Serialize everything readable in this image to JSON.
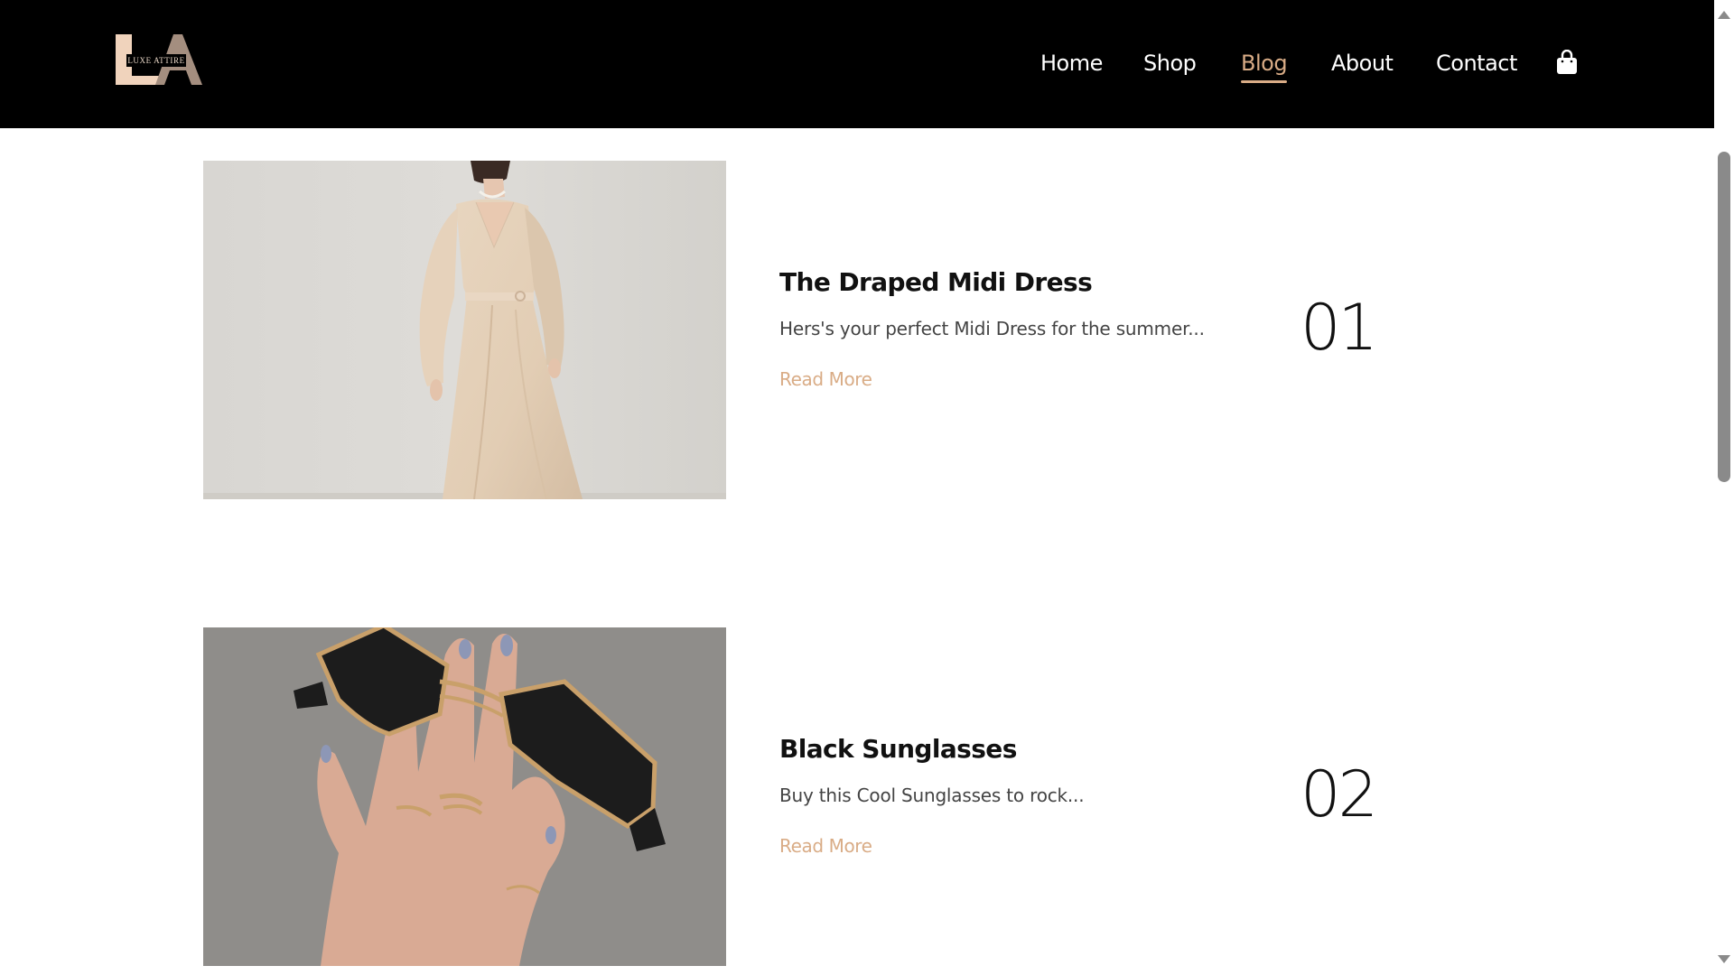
{
  "header": {
    "logo_text": "LUXE ATTIRE",
    "logo_monogram": "LA",
    "nav": [
      {
        "label": "Home"
      },
      {
        "label": "Shop"
      },
      {
        "label": "Blog",
        "active": true
      },
      {
        "label": "About"
      },
      {
        "label": "Contact"
      }
    ],
    "cart_icon": "shopping-bag-icon"
  },
  "colors": {
    "header_bg": "#000000",
    "accent": "#d9ac86",
    "text": "#111111"
  },
  "posts": [
    {
      "title": "The Draped Midi Dress",
      "excerpt": "Hers's your perfect Midi Dress for the summer...",
      "read_more": "Read More",
      "number": "01",
      "image": "woman in beige draped midi dress"
    },
    {
      "title": "Black Sunglasses",
      "excerpt": "Buy this Cool Sunglasses to rock...",
      "read_more": "Read More",
      "number": "02",
      "image": "hand holding black gold-framed sunglasses"
    }
  ]
}
